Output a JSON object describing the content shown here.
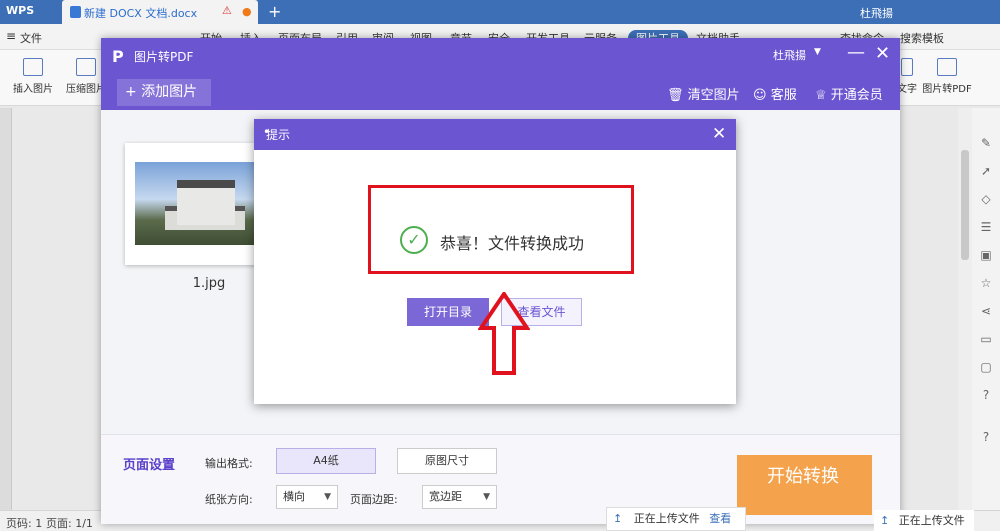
{
  "wps": {
    "logo": "WPS",
    "doc_tab": "新建 DOCX 文档.docx",
    "user": "杜飛揚",
    "menu_file": "文件",
    "menu_items": [
      "开始",
      "插入",
      "页面布局",
      "引用",
      "审阅",
      "视图",
      "章节",
      "安全",
      "开发工具",
      "云服务",
      "图片工具",
      "文档助手"
    ],
    "search_cmd": "查找命令",
    "search_tpl": "搜索模板",
    "ribbon": {
      "insert_image": "插入图片",
      "compress_image": "压缩图片",
      "to_text": "文字",
      "image_to_pdf": "图片转PDF"
    },
    "status": {
      "page_code": "页码: 1",
      "page": "页面: 1/1"
    },
    "upload_text": "正在上传文件",
    "upload_view": "查看"
  },
  "app": {
    "title": "图片转PDF",
    "user": "杜飛揚",
    "add_image": "添加图片",
    "clear_images": "清空图片",
    "support": "客服",
    "vip": "开通会员",
    "file_name": "1.jpg",
    "footer": {
      "page_settings": "页面设置",
      "output_format_label": "输出格式:",
      "format_a4": "A4纸",
      "format_original": "原图尺寸",
      "orientation_label": "纸张方向:",
      "orientation_value": "横向",
      "margin_label": "页面边距:",
      "margin_value": "宽边距",
      "start": "开始转换"
    }
  },
  "dialog": {
    "title": "提示",
    "message": "恭喜！文件转换成功",
    "open_dir": "打开目录",
    "view_file": "查看文件"
  },
  "colors": {
    "accent": "#6c55d1",
    "highlight": "#e0121e",
    "success": "#4caf50",
    "start": "#f4a24b"
  }
}
